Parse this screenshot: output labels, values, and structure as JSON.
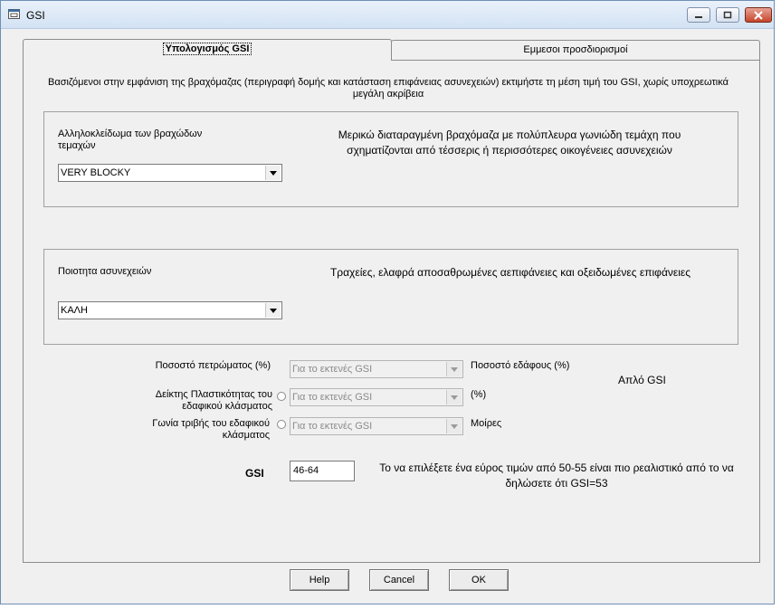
{
  "window": {
    "title": "GSI"
  },
  "tabs": [
    {
      "label": "Υπολογισμός GSI",
      "active": true
    },
    {
      "label": "Εμμεσοι προσδιορισμοί",
      "active": false
    }
  ],
  "intro": "Βασιζόμενοι στην εμφάνιση της βραχόμαζας (περιγραφή δομής και κατάσταση επιφάνειας ασυνεχειών) εκτιμήστε τη μέση τιμή του GSI, χωρίς υποχρεωτικά μεγάλη ακρίβεια",
  "structure": {
    "label": "Αλληλοκλείδωμα των βραχώδων τεμαχών",
    "value": "VERY BLOCKY",
    "description": "Μερικώ διαταραγμένη βραχόμαζα με πολύπλευρα γωνιώδη τεμάχη που σχηματίζονται από τέσσερις ή περισσότερες οικογένειες ασυνεχειών"
  },
  "quality": {
    "label": "Ποιοτητα ασυνεχειών",
    "value": "ΚΑΛΗ",
    "description": "Τραχείες, ελαφρά αποσαθρωμένες αεπιφάνειες και οξειδωμένες επιφάνειες"
  },
  "fields": {
    "rock_percent_label": "Ποσοστό πετρώματος (%)",
    "rock_percent_value": "Για το εκτενές GSI",
    "soil_percent_label": "Ποσοστό εδάφους (%)",
    "plasticity_label": "Δείκτης Πλαστικότητας του εδαφικού κλάσματος",
    "plasticity_value": "Για το εκτενές GSI",
    "plasticity_unit": "(%)",
    "friction_label": "Γωνία τριβής του εδαφικού κλάσματος",
    "friction_value": "Για το εκτενές GSI",
    "friction_unit": "Μοίρες",
    "simple_gsi": "Απλό GSI"
  },
  "gsi": {
    "label": "GSI",
    "value": "46-64",
    "note": "Το να επιλέξετε ένα εύρος τιμών από 50-55 είναι πιο ρεαλιστικό από το να δηλώσετε ότι GSI=53"
  },
  "buttons": {
    "help": "Help",
    "cancel": "Cancel",
    "ok": "OK"
  }
}
